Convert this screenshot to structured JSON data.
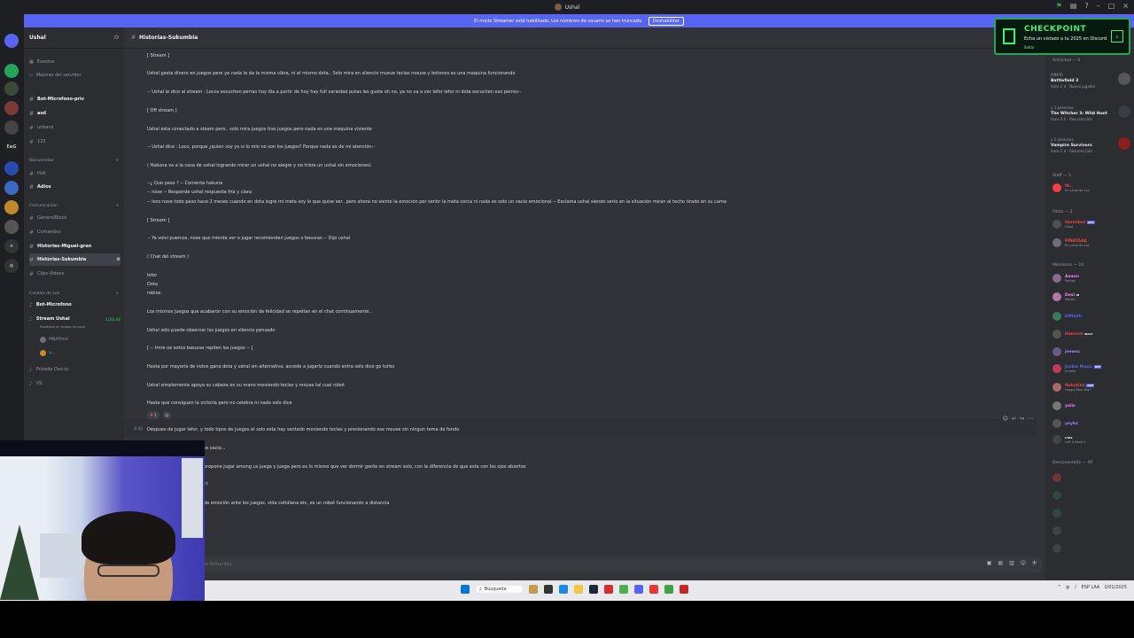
{
  "window": {
    "title": "Ushal"
  },
  "banner": {
    "text": "El modo Streamer está habilitado. Los nombres de usuario se han truncado.",
    "button": "Deshabilitar"
  },
  "server": {
    "name": "Ushal"
  },
  "sidebar": {
    "top_items": [
      "Eventos",
      "Mejoras del servidor"
    ],
    "channels_a": [
      "Bot-Microfono-priv",
      "asd",
      "unbans",
      "123"
    ],
    "cat_bienvenidas": "Bienvenidas",
    "channels_b": [
      "Holi",
      "Adios"
    ],
    "cat_comunicacion": "Comunicacion",
    "channels_c": [
      "GeneralBlack",
      "Comandos",
      "Historias-Miguel-gran",
      "Historias-Sukumbia",
      "Clips-Videos"
    ],
    "cat_voz": "Canales de voz",
    "voice_channels": [
      "Bot-Microfono",
      "Stream Ushal"
    ],
    "stream_time": "1:31:34",
    "stream_status": "Establece un estado de canal",
    "voice_users": [
      "PIÑATAAA",
      "u..."
    ],
    "voice_channels_b": [
      "Privado Das-cc",
      "VS"
    ]
  },
  "channel": {
    "name": "Historias-Sukumbia"
  },
  "messages": [
    "[ Stream ]",
    "Ushal gasta dinero en juegos pero ya nada le da la misma vibra, ni el mismo dota.. Solo mira en silencio mueve teclas mouse y botones es una maquina funcionando",
    "-- Ushal le dice al stream : Locos escuchen perras hoy dia a partir de hoy hay full variedad putas les guste oh no, ya no va a ver lefor lefor ni dota escuchen eso perros--",
    "[ Off stream ]",
    "Ushal esta conectado a steam pero.. solo mira juegos tras juegos pero nada es una maquina viviente",
    "-- Ushal dice : Loco, porque ¿quien soy yo si lo mio no son los juegos? Porque nada es de mi atención--",
    "( Hakuna va a la casa de ushal logrando mirar un ushal no alegre y no triste un ushal sin emociones)",
    "--¿ Que paso ? -- Comenta hakuna",
    "-- nose -- Responde ushal respuesta fría y clara",
    "-- loco nose todo paso hace 2 meses cuando en dota logre mi meta soy lo que quise ser.. pero ahora no siento la emoción por sentir la meta cerca ni nada es solo un vacío emocional -- Exclama ushal siendo serio en la situación miran al techo tirado en su cama",
    "[ Stream ]",
    "-- Ya volvi puercos, nose que mierda ver o jugar recomienden juegos o basuras -- Dijo ushal",
    "( Chat del stream )",
    "lefor",
    "Dota",
    "roblox",
    "Los mismos juegos que acabaron con su emoción de felicidad se repetían en el chat continuamente..",
    "Ushal solo puede observar los juegos en silencio pensado",
    "[ -- tmre oe estos basuras repiten los juegos -- ]",
    "Hasta por mayoría de votos gana dota y ushal sin alternativa, accede a jugarlo cuando entra solo dice go turbo",
    "Ushal simplemente apoya su cabeza en su mano moviendo teclas y mouse tal cual robot",
    "Hasta que consiguen la victoria pero no celebra ni nada solo dice",
    "Despues de jugar lefor, y todo tipos de juegos el solo esta hay sentado moviendo teclas y presionando ese mouse sin ningun tema de fondo",
    "te vacio...",
    "propone jugar among us juega y juega pero es lo mismo que ver dormir gente en stream solo, con la diferencia de que esta con los ojos abiertos",
    "r?",
    "de emoción ante los juegos, vida cotidiana etc, es un robot funcionando a distancia"
  ],
  "timestamp": "2:42",
  "reaction": {
    "count": "1"
  },
  "composer": {
    "placeholder": "ias-Sukumbia"
  },
  "members": {
    "activity_header": "Actividad — 0",
    "activities": [
      {
        "line1": "PIÑATA",
        "game": "Battlefield 3",
        "line3": "hace 2 d · Nuevo jugador"
      },
      {
        "line1": "y 3 personas",
        "game": "The Witcher 3: Wild Hunt",
        "line3": "hace 3 h · Resurrección"
      },
      {
        "line1": "y 2 personas",
        "game": "Vampire Survivors",
        "line3": "hace 2 d · Resurrección"
      }
    ],
    "staff_header": "Staff — 1",
    "staff": [
      {
        "name": "W...",
        "sub": "En canal de voz",
        "color": "#f23f43"
      }
    ],
    "pilots_header": "Piloto — 2",
    "pilots": [
      {
        "name": "Hennibot",
        "sub": "Dropi",
        "color": "#ed4245",
        "tag": "APP"
      },
      {
        "name": "PIÑATAAA",
        "sub": "En canal de voz",
        "color": "#ed4245"
      }
    ],
    "members_header": "Miembros — 10",
    "members": [
      {
        "name": "Aaaun",
        "sub": "Roblox",
        "color": "#f47fff"
      },
      {
        "name": "Desi",
        "sub": "Roblox",
        "color": "#f47fff",
        "tag": "HI"
      },
      {
        "name": "ElMaith",
        "sub": "",
        "color": "#5865f2"
      },
      {
        "name": "Hamoch",
        "sub": "",
        "color": "#ed4245",
        "tag": "WCLF"
      },
      {
        "name": "jeeeea",
        "sub": "",
        "color": "#a57cff"
      },
      {
        "name": "Jockie Music",
        "sub": "m!help",
        "color": "#5865f2",
        "tag": "APP"
      },
      {
        "name": "Nekotina",
        "sub": "Happy New Year!",
        "color": "#ed4245",
        "tag": "APP"
      },
      {
        "name": "yaliz",
        "sub": "",
        "color": "#f47fff"
      },
      {
        "name": "yeyko",
        "sub": "",
        "color": "#a57cff"
      },
      {
        "name": "",
        "sub": "Left 4 Dead 2",
        "color": "#f2f3f5",
        "tag": "L4D2"
      }
    ],
    "offline_header": "Desconectado — 49"
  },
  "checkpoint": {
    "title": "CHECKPOINT",
    "desc": "Echa un vistazo a tu 2025 en Discord",
    "skip": "Saltar"
  },
  "taskbar": {
    "search": "Búsqueda",
    "lang": "ESP LAA",
    "date": "2/01/2025"
  },
  "colors": {
    "accent": "#5865f2",
    "checkpoint": "#3bf07a",
    "online": "#23a55a"
  }
}
